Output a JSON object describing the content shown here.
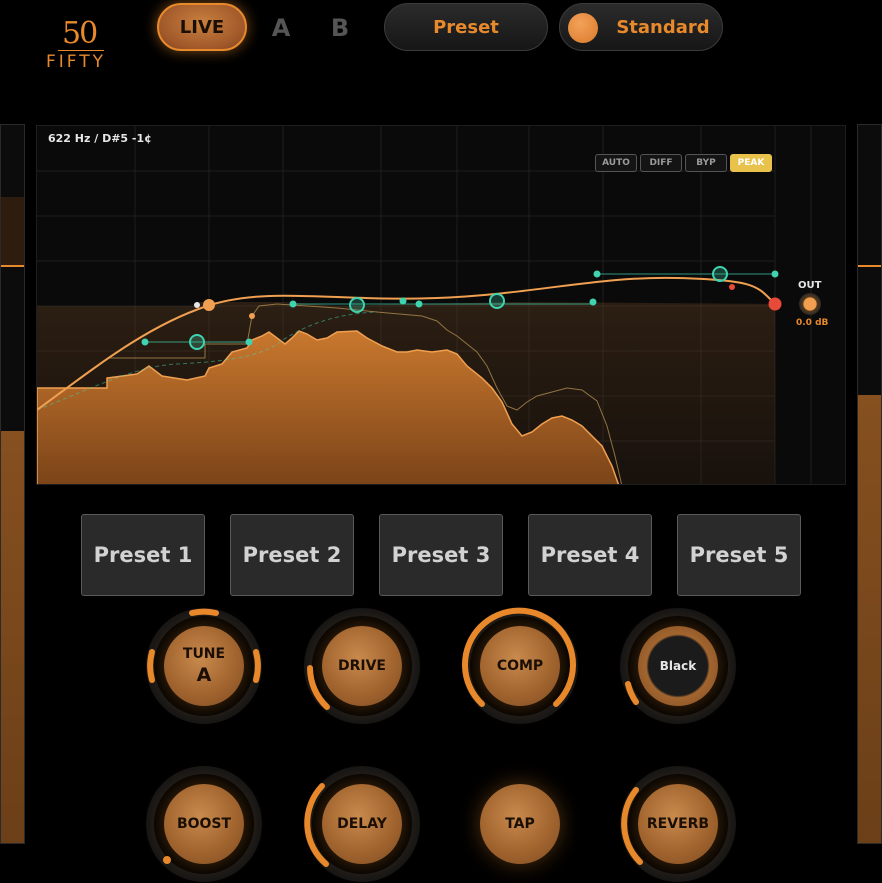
{
  "logo": {
    "number": "50",
    "word": "FIFTY"
  },
  "header": {
    "live_label": "LIVE",
    "a_label": "A",
    "b_label": "B",
    "preset_label": "Preset",
    "standard_label": "Standard"
  },
  "analyzer": {
    "readout": "622 Hz  /  D#5 -1¢",
    "modes": [
      {
        "label": "AUTO",
        "active": false
      },
      {
        "label": "DIFF",
        "active": false
      },
      {
        "label": "BYP",
        "active": false
      },
      {
        "label": "PEAK",
        "active": true
      }
    ],
    "out_label": "OUT",
    "out_value": "0.0 dB"
  },
  "presets": [
    "Preset 1",
    "Preset 2",
    "Preset 3",
    "Preset 4",
    "Preset 5"
  ],
  "knobs": {
    "tune": {
      "label": "TUNE",
      "sub": "A"
    },
    "drive": {
      "label": "DRIVE"
    },
    "comp": {
      "label": "COMP"
    },
    "black": {
      "label": "Black"
    },
    "boost": {
      "label": "BOOST"
    },
    "delay": {
      "label": "DELAY"
    },
    "tap": {
      "label": "TAP"
    },
    "reverb": {
      "label": "REVERB"
    }
  },
  "colors": {
    "accent": "#e8892c",
    "node": "#3fd3b0",
    "peak_button": "#e9c24c",
    "out_node": "#e84a3a"
  }
}
